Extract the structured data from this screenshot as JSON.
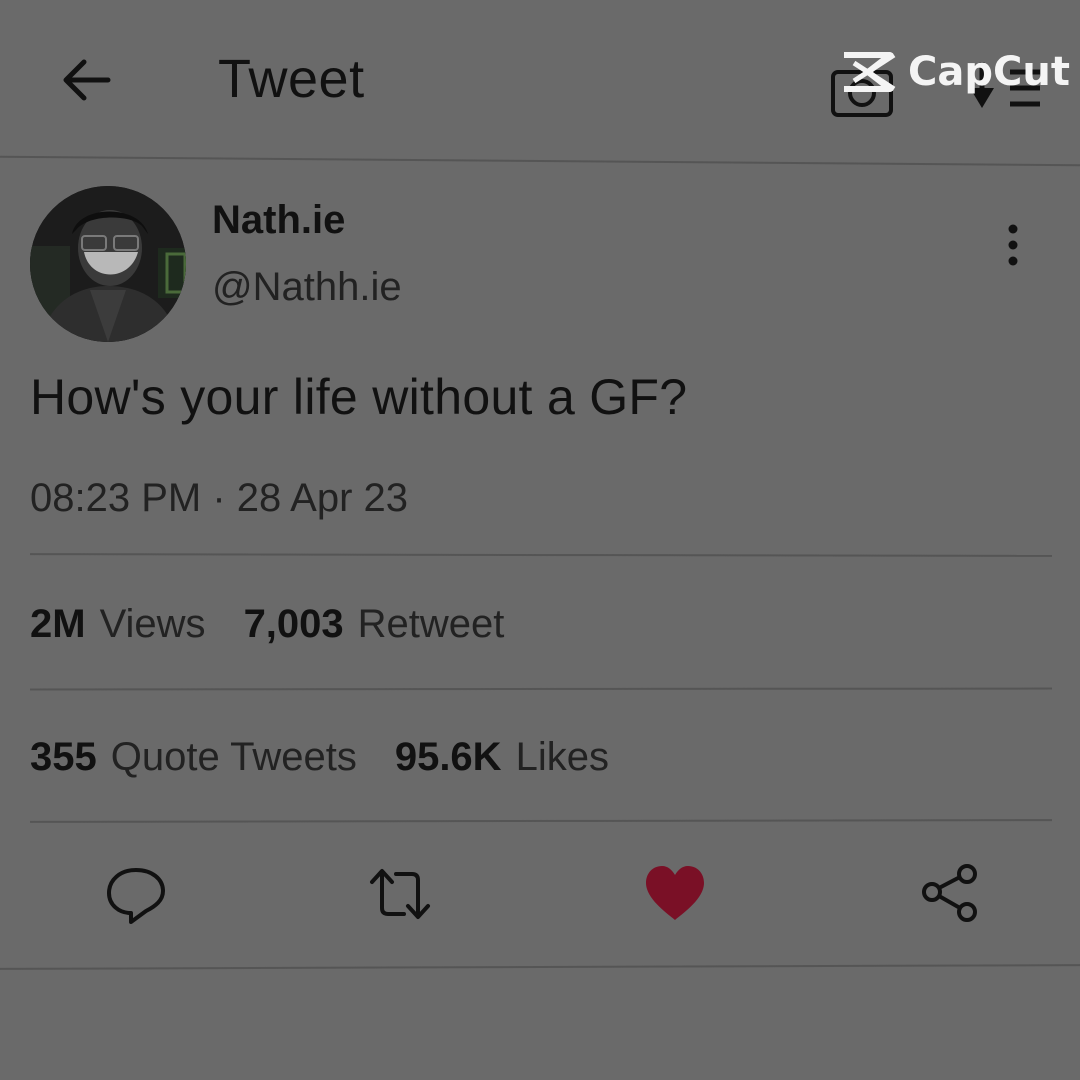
{
  "header": {
    "title": "Tweet",
    "back_icon": "arrow-left-icon",
    "camera_icon": "camera-icon",
    "sort_icon": "sort-icon"
  },
  "watermark": {
    "text": "CapCut",
    "icon": "capcut-logo-icon"
  },
  "tweet": {
    "display_name": "Nath.ie",
    "handle": "@Nathh.ie",
    "text": "How's your life without a GF?",
    "timestamp": "08:23 PM · 28 Apr 23",
    "more_icon": "more-vertical-icon"
  },
  "stats": {
    "views": {
      "value": "2M",
      "label": "Views"
    },
    "retweets": {
      "value": "7,003",
      "label": "Retweet"
    },
    "quotes": {
      "value": "355",
      "label": "Quote Tweets"
    },
    "likes": {
      "value": "95.6K",
      "label": "Likes"
    }
  },
  "actions": {
    "reply_icon": "reply-icon",
    "retweet_icon": "retweet-icon",
    "like_icon": "heart-icon",
    "share_icon": "share-icon"
  },
  "colors": {
    "overlay_bg": "#6a6a6a",
    "like": "#7a1026",
    "text": "#111111",
    "divider": "#555555"
  }
}
